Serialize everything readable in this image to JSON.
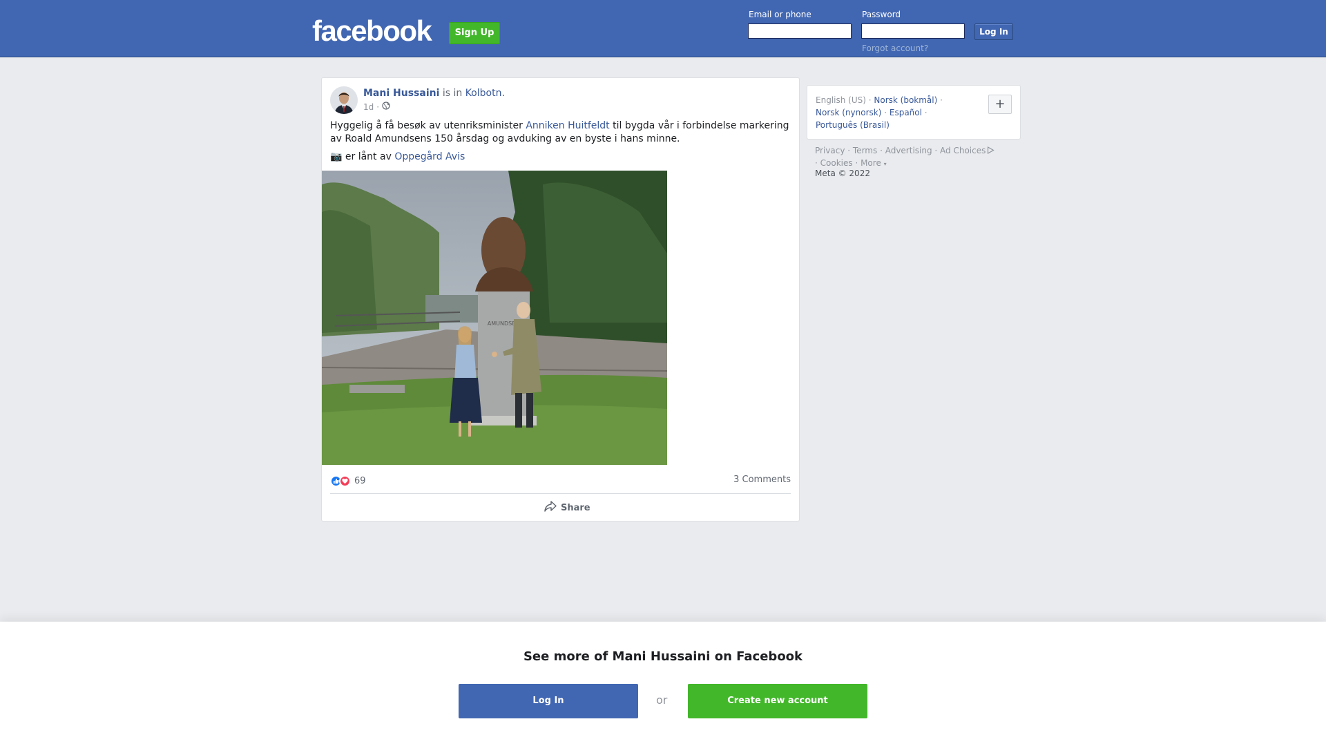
{
  "header": {
    "logo": "facebook",
    "signup_label": "Sign Up",
    "email_label": "Email or phone",
    "email_value": "",
    "password_label": "Password",
    "password_value": "",
    "login_label": "Log In",
    "forgot_label": "Forgot account?"
  },
  "post": {
    "author": "Mani Hussaini",
    "is_in": "is in",
    "location": "Kolbotn.",
    "time": "1d",
    "time_separator": "·",
    "privacy_icon": "globe-icon",
    "text_part1": "Hyggelig å få besøk av utenriksminister",
    "mention": "Anniken Huitfeldt",
    "text_part2": "til bygda vår i forbindelse markering av Roald Amundsens 150 årsdag og avduking av en byste i hans minne.",
    "camera_emoji": "📷",
    "credit_text": "er lånt av",
    "credit_link": "Oppegård Avis",
    "photo_statue_label": "AMUNDSEN",
    "reaction_count": "69",
    "comments": "3 Comments",
    "share_label": "Share"
  },
  "sidebar": {
    "languages": [
      {
        "label": "English (US)",
        "link": false
      },
      {
        "label": "Norsk (bokmål)",
        "link": true
      },
      {
        "label": "Norsk (nynorsk)",
        "link": true
      },
      {
        "label": "Español",
        "link": true
      },
      {
        "label": "Português (Brasil)",
        "link": true
      }
    ],
    "add_language": "+",
    "footer_links": [
      "Privacy",
      "Terms",
      "Advertising",
      "Ad Choices",
      "Cookies",
      "More"
    ],
    "copyright": "Meta © 2022"
  },
  "banner": {
    "title": "See more of Mani Hussaini on Facebook",
    "login_label": "Log In",
    "or_label": "or",
    "create_label": "Create new account"
  },
  "colors": {
    "brand_blue": "#4267b2",
    "link_blue": "#385898",
    "green": "#42b72a",
    "background": "#e9ebee"
  }
}
